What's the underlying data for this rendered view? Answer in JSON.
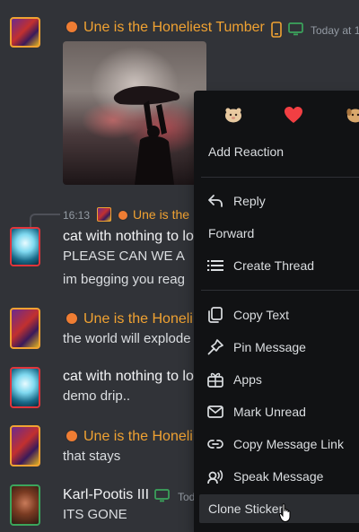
{
  "messages": {
    "m1": {
      "author": "Une is the Honeliest Tumber",
      "timestamp": "Today at 1"
    },
    "m2": {
      "reply_time": "16:13",
      "reply_author": "Une is the",
      "author": "cat with nothing to lo",
      "line1": "PLEASE CAN WE A",
      "line2": "im begging you reag"
    },
    "m3": {
      "author": "Une is the Honeli",
      "text": "the world will explode"
    },
    "m4": {
      "author": "cat with nothing to lo",
      "text": "demo drip.."
    },
    "m5": {
      "author": "Une is the Honeli",
      "text": "that stays"
    },
    "m6": {
      "author": "Karl-Pootis III",
      "timestamp": "Tod",
      "text": "ITS GONE"
    }
  },
  "context_menu": {
    "reactions": [
      "hamster-emoji",
      "heart-emoji",
      "dog-emoji"
    ],
    "items": [
      {
        "id": "add-reaction",
        "label": "Add Reaction",
        "icon": ""
      },
      {
        "id": "reply",
        "label": "Reply",
        "icon": "reply-icon"
      },
      {
        "id": "forward",
        "label": "Forward",
        "icon": ""
      },
      {
        "id": "create-thread",
        "label": "Create Thread",
        "icon": "thread-icon"
      },
      {
        "id": "copy-text",
        "label": "Copy Text",
        "icon": "copy-icon"
      },
      {
        "id": "pin-message",
        "label": "Pin Message",
        "icon": "pin-icon"
      },
      {
        "id": "apps",
        "label": "Apps",
        "icon": "apps-icon"
      },
      {
        "id": "mark-unread",
        "label": "Mark Unread",
        "icon": "envelope-icon"
      },
      {
        "id": "copy-message-link",
        "label": "Copy Message Link",
        "icon": "link-icon"
      },
      {
        "id": "speak-message",
        "label": "Speak Message",
        "icon": "speak-icon"
      },
      {
        "id": "clone-sticker",
        "label": "Clone Sticker",
        "icon": ""
      }
    ]
  },
  "colors": {
    "background": "#313338",
    "menu": "#111214",
    "username_orange": "#f0a232",
    "status_dot": "#ef7d33",
    "hover": "#2b2d31"
  }
}
